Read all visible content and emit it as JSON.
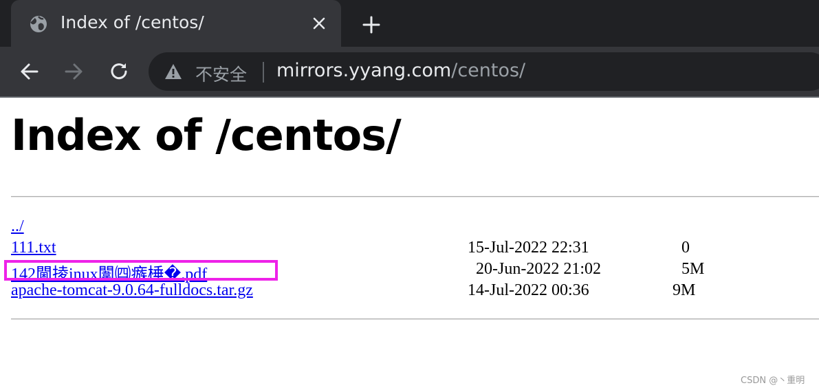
{
  "browser": {
    "tab": {
      "title": "Index of /centos/"
    },
    "omnibox": {
      "security_label": "不安全",
      "url_host": "mirrors.yyang.com",
      "url_path": "/centos/"
    }
  },
  "page": {
    "heading": "Index of /centos/",
    "entries": [
      {
        "name": "../",
        "date": "",
        "size": ""
      },
      {
        "name": "111.txt",
        "date": "15-Jul-2022 22:31",
        "size": "0"
      },
      {
        "name": "142閫掕inux闈㈣瘯棰�.pdf",
        "date": "20-Jun-2022 21:02",
        "size": "5M"
      },
      {
        "name": "apache-tomcat-9.0.64-fulldocs.tar.gz",
        "date": "14-Jul-2022 00:36",
        "size": "9M"
      }
    ]
  },
  "watermark": "CSDN @丶重明",
  "colors": {
    "highlight": "#ee22e8",
    "link": "#0000ee",
    "chrome_dark": "#202124",
    "chrome_toolbar": "#35363a"
  }
}
